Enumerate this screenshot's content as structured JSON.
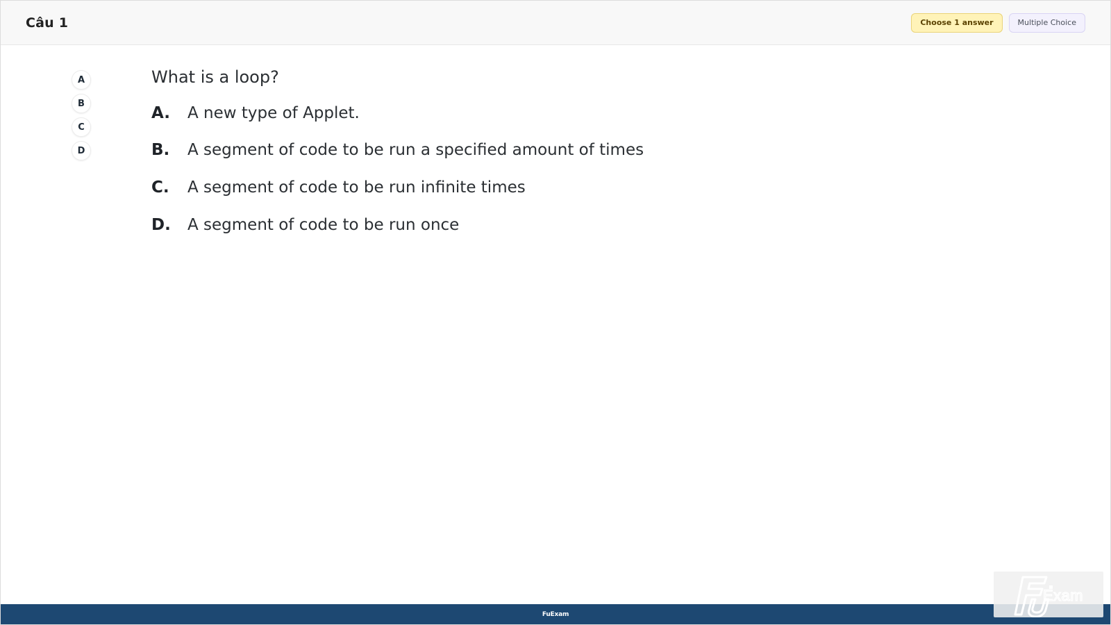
{
  "header": {
    "title": "Câu 1",
    "badges": {
      "choose": "Choose 1 answer",
      "type": "Multiple Choice"
    }
  },
  "answer_sidebar": {
    "items": [
      "A",
      "B",
      "C",
      "D"
    ]
  },
  "question": {
    "text": "What is a loop?",
    "options": [
      {
        "letter": "A.",
        "text": "A new type of Applet."
      },
      {
        "letter": "B.",
        "text": "A segment of code to be run a specified amount of times"
      },
      {
        "letter": "C.",
        "text": "A segment of code to be run infinite times"
      },
      {
        "letter": "D.",
        "text": "A segment of code to be run once"
      }
    ]
  },
  "footer": {
    "text": "FuExam"
  },
  "logo": {
    "text": "FU Exam"
  }
}
